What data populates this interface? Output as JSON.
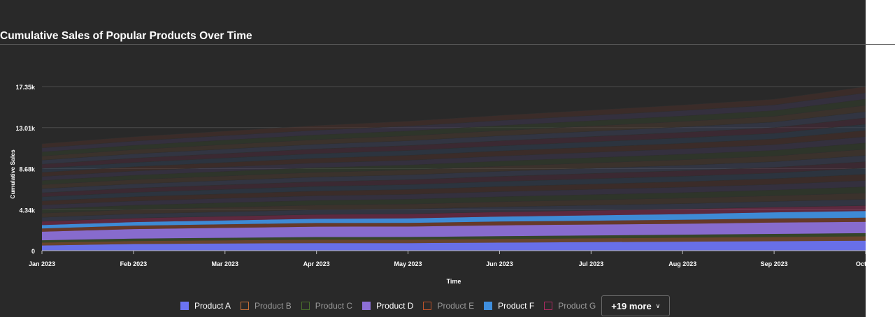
{
  "title": "Cumulative Sales of Popular Products Over Time",
  "legend": {
    "items": [
      {
        "label": "Product A",
        "color": "#6b73f2",
        "active": true
      },
      {
        "label": "Product B",
        "color": "#e07a3a",
        "active": false
      },
      {
        "label": "Product C",
        "color": "#4e7a2c",
        "active": false
      },
      {
        "label": "Product D",
        "color": "#8c6fd6",
        "active": true
      },
      {
        "label": "Product E",
        "color": "#d65a2a",
        "active": false
      },
      {
        "label": "Product F",
        "color": "#3f8fde",
        "active": true
      },
      {
        "label": "Product G",
        "color": "#c02a6a",
        "active": false
      }
    ],
    "more_label": "+19 more",
    "more_icon": "chevron-down-icon"
  },
  "chart_data": {
    "type": "area",
    "stacked": true,
    "xlabel": "Time",
    "ylabel": "Cumulative Sales",
    "x": [
      "Jan 2023",
      "Feb 2023",
      "Mar 2023",
      "Apr 2023",
      "May 2023",
      "Jun 2023",
      "Jul 2023",
      "Aug 2023",
      "Sep 2023",
      "Oct"
    ],
    "yticks": [
      "0",
      "4.34k",
      "8.68k",
      "13.01k",
      "17.35k"
    ],
    "ylim": [
      0,
      17350
    ],
    "grid": true,
    "legend_position": "bottom",
    "series": [
      {
        "name": "Product A",
        "values": [
          550,
          700,
          750,
          800,
          800,
          850,
          900,
          950,
          1000,
          1050
        ],
        "highlighted": true
      },
      {
        "name": "Product B",
        "values": [
          300,
          320,
          340,
          360,
          360,
          380,
          400,
          420,
          440,
          460
        ],
        "highlighted": false
      },
      {
        "name": "Product C",
        "values": [
          250,
          260,
          270,
          280,
          290,
          300,
          310,
          320,
          330,
          340
        ],
        "highlighted": false
      },
      {
        "name": "Product D",
        "values": [
          900,
          1000,
          1050,
          1100,
          1100,
          1150,
          1150,
          1150,
          1200,
          1200
        ],
        "highlighted": true
      },
      {
        "name": "Product E",
        "values": [
          350,
          360,
          370,
          380,
          390,
          400,
          410,
          420,
          430,
          440
        ],
        "highlighted": false
      },
      {
        "name": "Product F",
        "values": [
          350,
          380,
          420,
          450,
          470,
          520,
          560,
          600,
          650,
          700
        ],
        "highlighted": true
      },
      {
        "name": "Product G",
        "values": [
          400,
          420,
          440,
          460,
          480,
          500,
          520,
          540,
          560,
          580
        ],
        "highlighted": false
      }
    ],
    "hidden_series_count": 19,
    "hidden_series_total": [
      8200,
      8600,
      9000,
      9400,
      9800,
      10200,
      10600,
      11000,
      11400,
      12580
    ]
  }
}
